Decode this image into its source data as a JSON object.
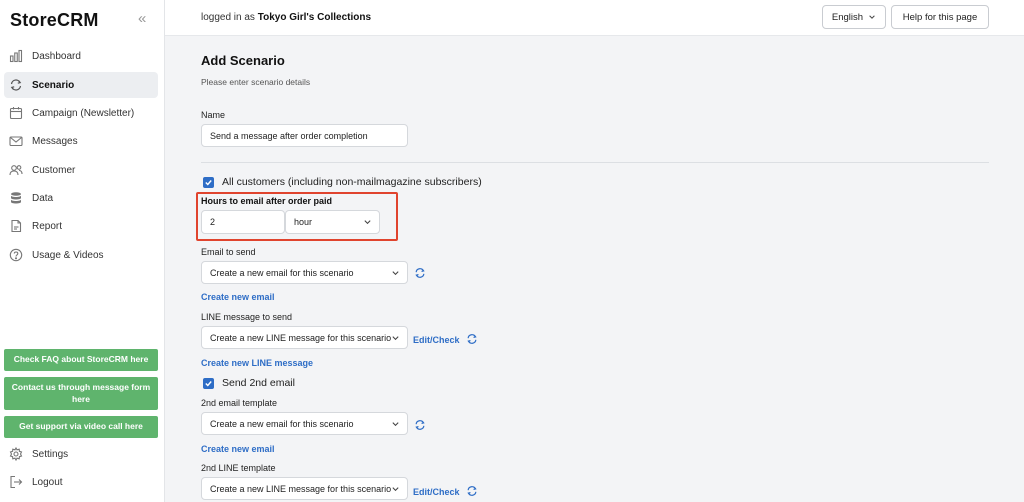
{
  "sidebar": {
    "brand": "StoreCRM",
    "collapse_icon": "«",
    "items": [
      {
        "label": "Dashboard",
        "icon": "bar-chart-icon"
      },
      {
        "label": "Scenario",
        "icon": "refresh-icon",
        "active": true
      },
      {
        "label": "Campaign (Newsletter)",
        "icon": "calendar-icon"
      },
      {
        "label": "Messages",
        "icon": "envelope-icon"
      },
      {
        "label": "Customer",
        "icon": "users-icon"
      },
      {
        "label": "Data",
        "icon": "database-icon"
      },
      {
        "label": "Report",
        "icon": "document-icon"
      },
      {
        "label": "Usage & Videos",
        "icon": "question-icon"
      }
    ],
    "green_buttons": [
      "Check FAQ about StoreCRM here",
      "Contact us through message form here",
      "Get support via video call here"
    ],
    "settings_label": "Settings",
    "logout_label": "Logout"
  },
  "topbar": {
    "login_prefix": "logged in as ",
    "store_name": "Tokyo Girl's Collections",
    "language": "English",
    "help_label": "Help for this page"
  },
  "form": {
    "title": "Add Scenario",
    "subtitle": "Please enter scenario details",
    "name_label": "Name",
    "name_value": "Send a message after order completion",
    "all_customers_label": "All customers (including non-mailmagazine subscribers)",
    "all_customers_checked": true,
    "hours_label": "Hours to email after order paid",
    "hours_value": "2",
    "hours_unit": "hour",
    "email_label": "Email to send",
    "email_select": "Create a new email for this scenario",
    "create_email_link": "Create new email",
    "line_label": "LINE message to send",
    "line_select": "Create a new LINE message for this scenario",
    "edit_check_label": "Edit/Check",
    "create_line_link": "Create new LINE message",
    "send_2nd_label": "Send 2nd email",
    "send_2nd_checked": true,
    "email2_label": "2nd email template",
    "email2_select": "Create a new email for this scenario",
    "create_email2_link": "Create new email",
    "line2_label": "2nd LINE template",
    "line2_select": "Create a new LINE message for this scenario",
    "edit_check2_label": "Edit/Check"
  },
  "colors": {
    "accent": "#2e6dc6",
    "green": "#5fb46d",
    "highlight": "#e0442e"
  }
}
